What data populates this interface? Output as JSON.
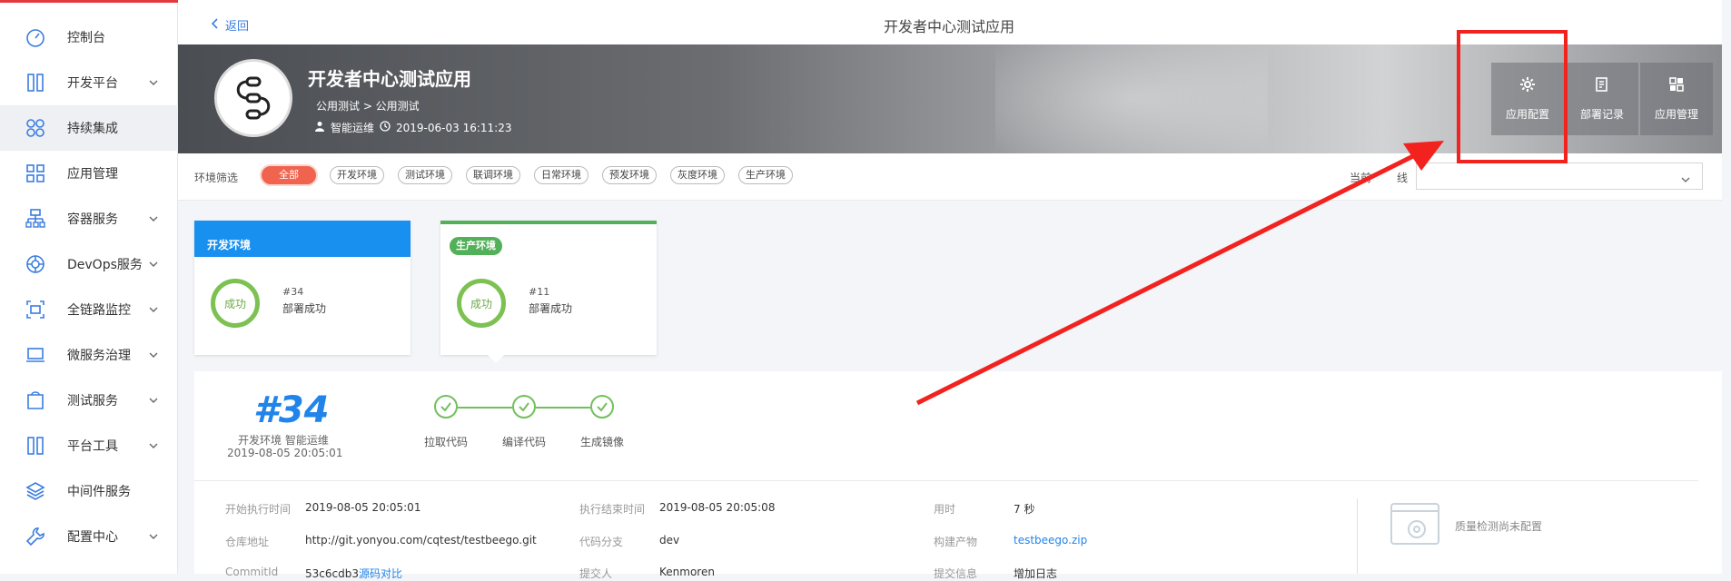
{
  "sidebar": {
    "items": [
      {
        "label": "控制台",
        "icon": "dashboard-icon",
        "has_chevron": false,
        "active": false
      },
      {
        "label": "开发平台",
        "icon": "dev-platform-icon",
        "has_chevron": true,
        "active": false
      },
      {
        "label": "持续集成",
        "icon": "ci-icon",
        "has_chevron": false,
        "active": true
      },
      {
        "label": "应用管理",
        "icon": "grid-icon",
        "has_chevron": false,
        "active": false
      },
      {
        "label": "容器服务",
        "icon": "container-icon",
        "has_chevron": true,
        "active": false
      },
      {
        "label": "DevOps服务",
        "icon": "devops-icon",
        "has_chevron": true,
        "active": false
      },
      {
        "label": "全链路监控",
        "icon": "monitor-icon",
        "has_chevron": true,
        "active": false
      },
      {
        "label": "微服务治理",
        "icon": "laptop-icon",
        "has_chevron": true,
        "active": false
      },
      {
        "label": "测试服务",
        "icon": "test-icon",
        "has_chevron": true,
        "active": false
      },
      {
        "label": "平台工具",
        "icon": "tools-icon",
        "has_chevron": true,
        "active": false
      },
      {
        "label": "中间件服务",
        "icon": "layers-icon",
        "has_chevron": false,
        "active": false
      },
      {
        "label": "配置中心",
        "icon": "wrench-icon",
        "has_chevron": true,
        "active": false
      }
    ]
  },
  "header": {
    "back_label": "返回",
    "title": "开发者中心测试应用"
  },
  "banner": {
    "app_name": "开发者中心测试应用",
    "crumb": "公用测试 > 公用测试",
    "owner": "智能运维",
    "created": "2019-06-03 16:11:23",
    "actions": [
      {
        "label": "应用配置",
        "icon": "gear-icon"
      },
      {
        "label": "部署记录",
        "icon": "record-icon"
      },
      {
        "label": "应用管理",
        "icon": "app-grid-icon"
      }
    ]
  },
  "filter": {
    "label": "环境筛选",
    "chips": [
      "全部",
      "开发环境",
      "测试环境",
      "联调环境",
      "日常环境",
      "预发环境",
      "灰度环境",
      "生产环境"
    ],
    "active_index": 0,
    "line_label": "当前",
    "line_label_tail": "线",
    "line_value": ""
  },
  "env_cards": [
    {
      "name": "开发环境",
      "status": "成功",
      "num": "#34",
      "result": "部署成功",
      "color": "#1890f0"
    },
    {
      "name": "生产环境",
      "status": "成功",
      "num": "#11",
      "result": "部署成功",
      "color": "#52b058"
    }
  ],
  "build": {
    "number": "#34",
    "env_user": "开发环境 智能运维",
    "time": "2019-08-05 20:05:01",
    "steps": [
      "拉取代码",
      "编译代码",
      "生成镜像"
    ]
  },
  "details": {
    "row1": [
      {
        "k": "开始执行时间",
        "v": "2019-08-05 20:05:01"
      },
      {
        "k": "执行结束时间",
        "v": "2019-08-05 20:05:08"
      },
      {
        "k": "用时",
        "v": "7 秒"
      }
    ],
    "row2": [
      {
        "k": "仓库地址",
        "v": "http://git.yonyou.com/cqtest/testbeego.git"
      },
      {
        "k": "代码分支",
        "v": "dev"
      },
      {
        "k": "构建产物",
        "v": "testbeego.zip"
      }
    ],
    "row3": [
      {
        "k": "CommitId",
        "v": "53c6cdb3",
        "v2": "源码对比"
      },
      {
        "k": "提交人",
        "v": "Kenmoren"
      },
      {
        "k": "提交信息",
        "v": "增加日志"
      }
    ],
    "quality": "质量检测尚未配置"
  },
  "colors": {
    "accent": "#2184ea",
    "success": "#72c05d",
    "annotation": "#f2231f"
  }
}
